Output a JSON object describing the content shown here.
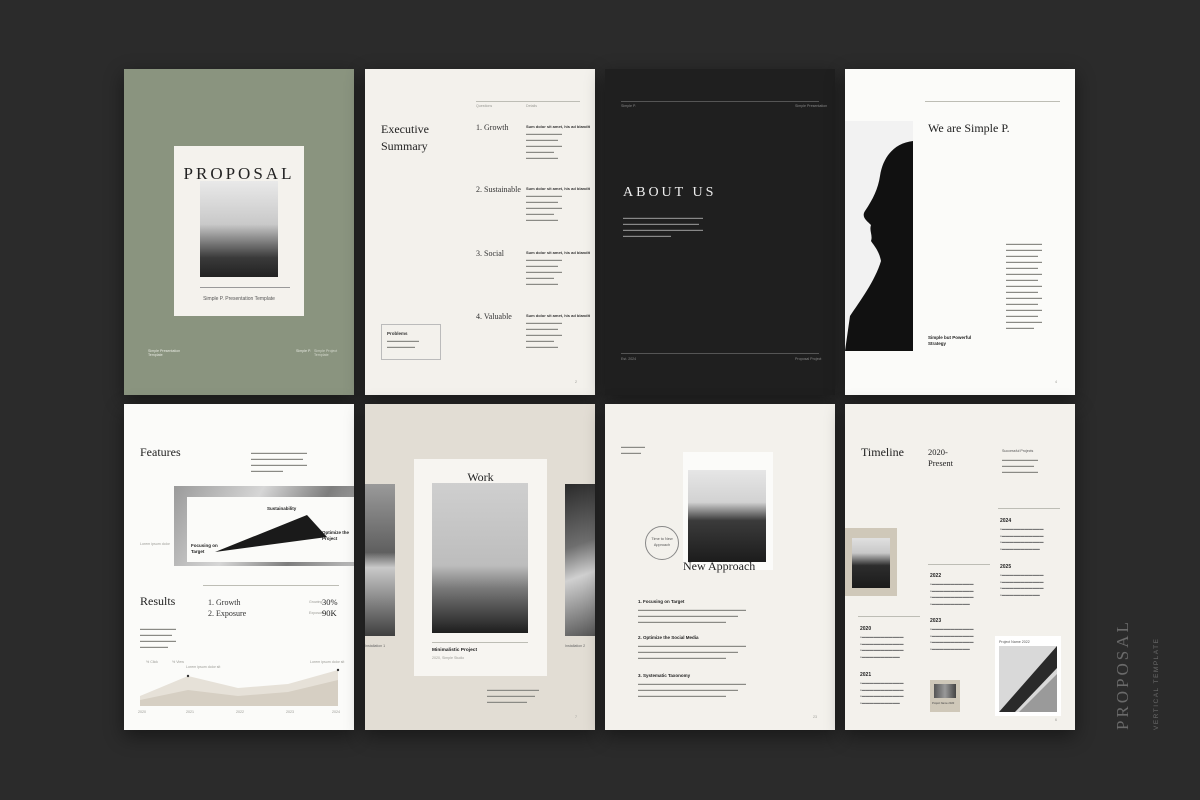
{
  "colors": {
    "background": "#2b2b2b",
    "sage": "#8a947f",
    "cream": "#f3f1ec",
    "dark": "#1f1f1f",
    "beige": "#e2ddd4"
  },
  "side_title": {
    "main": "PROPOSAL",
    "sub": "VERTICAL TEMPLATE"
  },
  "cover": {
    "title": "PROPOSAL",
    "subtitle": "Simple P. Presentation Template",
    "footer_left": "Simple Presentation Template",
    "footer_mid": "Simple P.",
    "footer_right": "Simple Project Template"
  },
  "exec": {
    "title_line1": "Executive",
    "title_line2": "Summary",
    "col1": "Questions",
    "col2": "Details",
    "items": [
      {
        "label": "1. Growth",
        "head": "Sum dolor sit amet, his ad blandit"
      },
      {
        "label": "2. Sustainable",
        "head": "Sum dolor sit amet, his ad blandit"
      },
      {
        "label": "3. Social",
        "head": "Sum dolor sit amet, his ad blandit"
      },
      {
        "label": "4. Valuable",
        "head": "Sum dolor sit amet, his ad blandit"
      }
    ],
    "problems": "Problems",
    "page": "2"
  },
  "about": {
    "header_left": "Simple P.",
    "header_right": "Simple Presentation",
    "title": "ABOUT US",
    "footer_left": "Est. 2024",
    "footer_right": "Proposal Project"
  },
  "we_are": {
    "title": "We are Simple P.",
    "caption_line1": "Simple but Powerful",
    "caption_line2": "Strategy",
    "page": "4"
  },
  "features": {
    "title": "Features",
    "label_top": "Sustainability",
    "label_left_1": "Focusing on",
    "label_left_2": "Target",
    "label_right_1": "Optimize the",
    "label_right_2": "Project",
    "side_note": "Lorem ipsum dolor",
    "results": "Results",
    "list1": "1. Growth",
    "list2": "2. Exposure",
    "stat1_label": "Growing",
    "stat1_value": "30%",
    "stat2_label": "Exposure",
    "stat2_value": "90K",
    "legend1": "% Click",
    "legend2": "% View",
    "chart_note1": "Lorem ipsum dolor sit",
    "chart_note2": "Lorem ipsum dolor sit",
    "x_ticks": [
      "2020",
      "2021",
      "2022",
      "2023",
      "2024"
    ]
  },
  "work": {
    "title": "Work",
    "project": "Minimalistic Project",
    "project_sub": "2020, Simple Studio",
    "inst_left": "Installation 1",
    "inst_right": "Installation 2",
    "page": "7"
  },
  "approach": {
    "circle_1": "Time to New",
    "circle_2": "Approach",
    "title": "New Approach",
    "s1": "1. Focusing on Target",
    "s2": "2. Optimize the Social Media",
    "s3": "3. Systematic Taxonomy",
    "page": "23"
  },
  "timeline": {
    "title": "Timeline",
    "year_line1": "2020-",
    "year_line2": "Present",
    "note": "Successful Projects",
    "years": [
      "2024",
      "2025",
      "2022",
      "2023",
      "2020",
      "2021"
    ],
    "project_label": "Project Name 2022",
    "project_label2": "Project Name 2020",
    "page": "6"
  }
}
